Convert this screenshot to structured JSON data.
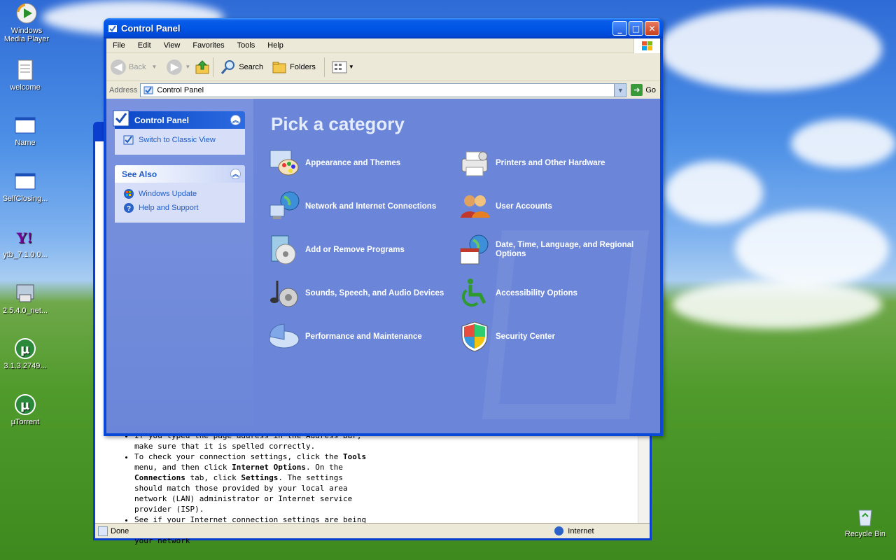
{
  "desktop": {
    "icons": [
      {
        "label": "Windows Media Player",
        "name": "wmp"
      },
      {
        "label": "welcome",
        "name": "welcome"
      },
      {
        "label": "Name",
        "name": "name"
      },
      {
        "label": "SelfClosing...",
        "name": "selfclosing"
      },
      {
        "label": "ytb_7.1.0.0...",
        "name": "ytb"
      },
      {
        "label": "2.5.4.0_net...",
        "name": "net"
      },
      {
        "label": "3.1.3.2749...",
        "name": "utorrent-installer"
      },
      {
        "label": "µTorrent",
        "name": "utorrent"
      },
      {
        "label": "Recycle Bin",
        "name": "recycle-bin"
      }
    ]
  },
  "ie_window": {
    "bullets": [
      "If you typed the page address in the Address Bar, make sure that it is spelled correctly.",
      "To check your connection settings, click the",
      "See if your Internet connection settings are being detected. You can set Microsoft Windows to examine your network"
    ],
    "b2_tools": "Tools",
    "b2_menu": "menu, and then click",
    "b2_io": "Internet Options",
    "b2_on": ". On the",
    "b2_conn": "Connections",
    "b2_tab": "tab, click",
    "b2_settings": "Settings",
    "b2_rest": ". The settings should match those provided by your local area network (LAN) administrator or Internet service provider (ISP).",
    "status_text": "Done",
    "zone_text": "Internet"
  },
  "window": {
    "title": "Control Panel",
    "menu": [
      "File",
      "Edit",
      "View",
      "Favorites",
      "Tools",
      "Help"
    ],
    "toolbar": {
      "back": "Back",
      "search": "Search",
      "folders": "Folders"
    },
    "address": {
      "label": "Address",
      "value": "Control Panel",
      "go": "Go"
    }
  },
  "left_pane": {
    "cp_panel": {
      "title": "Control Panel",
      "link": "Switch to Classic View"
    },
    "see_also": {
      "title": "See Also",
      "links": [
        "Windows Update",
        "Help and Support"
      ]
    }
  },
  "main": {
    "heading": "Pick a category",
    "categories": [
      {
        "label": "Appearance and Themes",
        "icon": "appearance-icon"
      },
      {
        "label": "Printers and Other Hardware",
        "icon": "printer-icon"
      },
      {
        "label": "Network and Internet Connections",
        "icon": "network-icon"
      },
      {
        "label": "User Accounts",
        "icon": "users-icon"
      },
      {
        "label": "Add or Remove Programs",
        "icon": "programs-icon"
      },
      {
        "label": "Date, Time, Language, and Regional Options",
        "icon": "datetime-icon"
      },
      {
        "label": "Sounds, Speech, and Audio Devices",
        "icon": "sound-icon"
      },
      {
        "label": "Accessibility Options",
        "icon": "accessibility-icon"
      },
      {
        "label": "Performance and Maintenance",
        "icon": "performance-icon"
      },
      {
        "label": "Security Center",
        "icon": "shield-icon"
      }
    ]
  },
  "colors": {
    "title_blue": "#0055e5",
    "content_blue": "#6b86d8",
    "link_blue": "#215dc6"
  }
}
